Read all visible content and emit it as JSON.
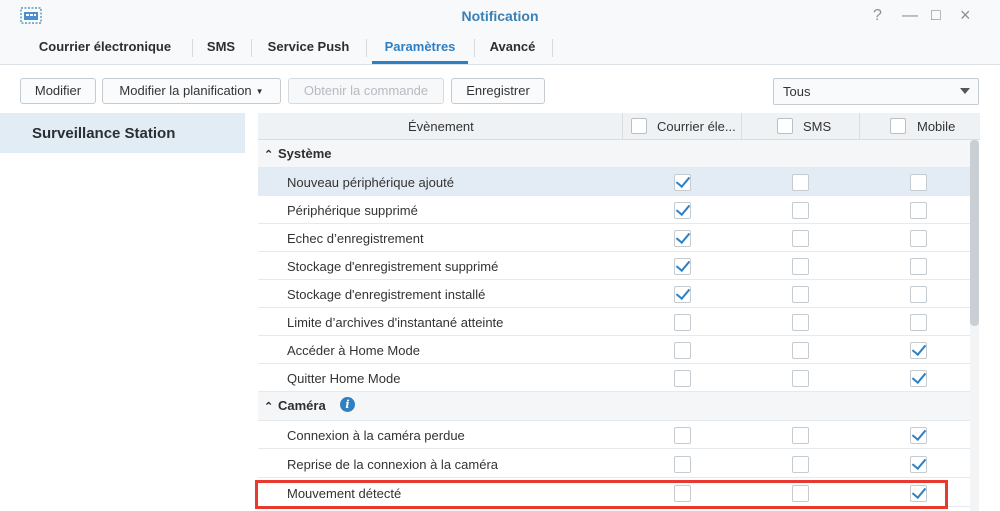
{
  "window": {
    "title": "Notification",
    "icon": "notification-app-icon",
    "controls": [
      "?",
      "—",
      "□",
      "×"
    ]
  },
  "tabs": [
    {
      "label": "Courrier électronique",
      "active": false
    },
    {
      "label": "SMS",
      "active": false
    },
    {
      "label": "Service Push",
      "active": false
    },
    {
      "label": "Paramètres",
      "active": true
    },
    {
      "label": "Avancé",
      "active": false
    }
  ],
  "toolbar": {
    "modify": "Modifier",
    "modify_schedule": "Modifier la planification",
    "get_command": "Obtenir la commande",
    "save": "Enregistrer",
    "filter_value": "Tous"
  },
  "sidebar": {
    "items": [
      {
        "label": "Surveillance Station",
        "selected": true
      }
    ]
  },
  "grid": {
    "headers": {
      "event": "Évènement",
      "email": "Courrier éle...",
      "sms": "SMS",
      "mobile": "Mobile"
    },
    "groups": [
      {
        "label": "Système",
        "rows": [
          {
            "event": "Nouveau périphérique ajouté",
            "email": true,
            "sms": false,
            "mobile": false,
            "selected": true
          },
          {
            "event": "Périphérique supprimé",
            "email": true,
            "sms": false,
            "mobile": false
          },
          {
            "event": "Echec d’enregistrement",
            "email": true,
            "sms": false,
            "mobile": false
          },
          {
            "event": "Stockage d'enregistrement supprimé",
            "email": true,
            "sms": false,
            "mobile": false
          },
          {
            "event": "Stockage d'enregistrement installé",
            "email": true,
            "sms": false,
            "mobile": false
          },
          {
            "event": "Limite d’archives d'instantané atteinte",
            "email": false,
            "sms": false,
            "mobile": false
          },
          {
            "event": "Accéder à Home Mode",
            "email": false,
            "sms": false,
            "mobile": true
          },
          {
            "event": "Quitter Home Mode",
            "email": false,
            "sms": false,
            "mobile": true
          }
        ]
      },
      {
        "label": "Caméra",
        "info_icon": "info-icon",
        "rows": [
          {
            "event": "Connexion à la caméra perdue",
            "email": false,
            "sms": false,
            "mobile": true
          },
          {
            "event": "Reprise de la connexion à la caméra",
            "email": false,
            "sms": false,
            "mobile": true
          },
          {
            "event": "Mouvement détecté",
            "email": false,
            "sms": false,
            "mobile": true,
            "highlighted": true
          }
        ]
      }
    ]
  },
  "colors": {
    "accent": "#2f80c3",
    "highlight": "#e8392f",
    "selected_row": "#e3ecf4"
  }
}
